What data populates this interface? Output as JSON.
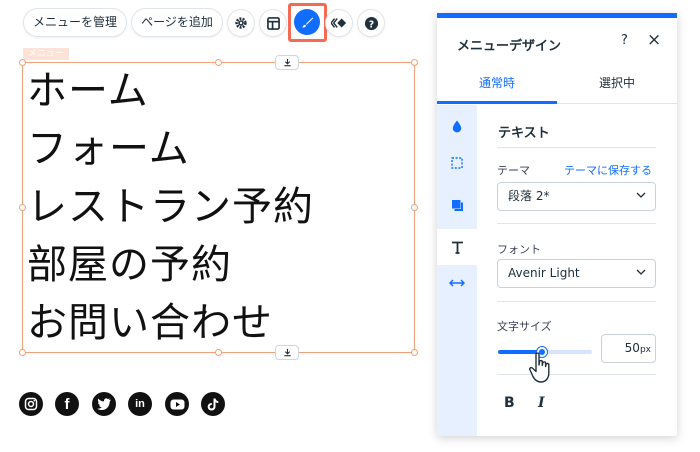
{
  "toolbar": {
    "manage_menu": "メニューを管理",
    "add_page": "ページを追加"
  },
  "menu_element": {
    "tag": "メニュー",
    "items": [
      "ホーム",
      "フォーム",
      "レストラン予約",
      "部屋の予約",
      "お問い合わせ"
    ]
  },
  "social": [
    {
      "name": "instagram",
      "glyph": "◎"
    },
    {
      "name": "facebook",
      "glyph": "f"
    },
    {
      "name": "twitter",
      "glyph": "🐦"
    },
    {
      "name": "linkedin",
      "glyph": "in"
    },
    {
      "name": "youtube",
      "glyph": "▶"
    },
    {
      "name": "tiktok",
      "glyph": "♪"
    }
  ],
  "panel": {
    "title": "メニューデザイン",
    "help": "?",
    "close": "×",
    "tabs": {
      "normal": "通常時",
      "selected": "選択中"
    },
    "section_title": "テキスト",
    "theme_label": "テーマ",
    "save_theme_link": "テーマに保存する",
    "theme_value": "段落 2*",
    "font_label": "フォント",
    "font_value": "Avenir Light",
    "size_label": "文字サイズ",
    "size_value": "50",
    "size_unit": "px",
    "size_slider_fraction": 0.47,
    "bold": "B",
    "italic": "I"
  },
  "colors": {
    "accent": "#116dff",
    "highlight": "#f26b52",
    "selection": "#f2a07a"
  }
}
